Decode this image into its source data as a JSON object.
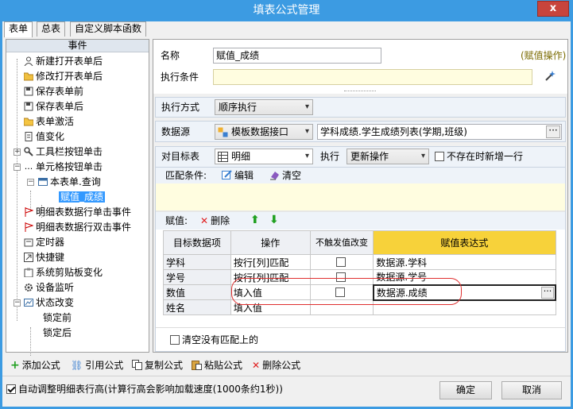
{
  "window": {
    "title": "填表公式管理",
    "close_glyph": "x"
  },
  "tabs": [
    {
      "label": "表单"
    },
    {
      "label": "总表"
    },
    {
      "label": "自定义脚本函数"
    }
  ],
  "tree": {
    "header": "事件",
    "nodes": [
      {
        "label": "新建打开表单后"
      },
      {
        "label": "修改打开表单后"
      },
      {
        "label": "保存表单前"
      },
      {
        "label": "保存表单后"
      },
      {
        "label": "表单激活"
      },
      {
        "label": "值变化"
      },
      {
        "label": "工具栏按钮单击"
      },
      {
        "label": "单元格按钮单击"
      },
      {
        "label": "本表单.查询"
      },
      {
        "label": "赋值_成绩"
      },
      {
        "label": "明细表数据行单击事件"
      },
      {
        "label": "明细表数据行双击事件"
      },
      {
        "label": "定时器"
      },
      {
        "label": "快捷键"
      },
      {
        "label": "系统剪贴板变化"
      },
      {
        "label": "设备监听"
      },
      {
        "label": "状态改变"
      },
      {
        "label": "锁定前"
      },
      {
        "label": "锁定后"
      }
    ]
  },
  "form": {
    "name_label": "名称",
    "name_value": "赋值_成绩",
    "op_type": "(赋值操作)",
    "cond_label": "执行条件",
    "cond_value": "",
    "exec_mode_label": "执行方式",
    "exec_mode_value": "顺序执行",
    "datasource_label": "数据源",
    "datasource_type": "模板数据接口",
    "datasource_value": "学科成绩.学生成绩列表(学期,班级)",
    "target_label": "对目标表",
    "target_value": "明细",
    "exec_label": "执行",
    "exec_value": "更新操作",
    "add_row_label": "不存在时新增一行",
    "match_label": "匹配条件:",
    "edit_label": "编辑",
    "clear_label": "清空",
    "assign_label": "赋值:",
    "delete_label": "删除",
    "clear_unmatched_label": "清空没有匹配上的"
  },
  "grid": {
    "headers": [
      "目标数据项",
      "操作",
      "不触发值改变",
      "赋值表达式"
    ],
    "rows": [
      {
        "target": "学科",
        "op": "按行[列]匹配",
        "nochange": false,
        "expr": "数据源.学科"
      },
      {
        "target": "学号",
        "op": "按行[列]匹配",
        "nochange": false,
        "expr": "数据源.学号"
      },
      {
        "target": "数值",
        "op": "填入值",
        "nochange": false,
        "expr": "数据源.成绩"
      },
      {
        "target": "姓名",
        "op": "填入值",
        "nochange": false,
        "expr": ""
      }
    ]
  },
  "toolbar": {
    "add": "添加公式",
    "ref": "引用公式",
    "copy": "复制公式",
    "paste": "粘贴公式",
    "del": "删除公式"
  },
  "footer": {
    "auto_height_label": "自动调整明细表行高(计算行高会影响加载速度(1000条约1秒))",
    "auto_height_checked": true,
    "ok": "确定",
    "cancel": "取消"
  },
  "colors": {
    "title_bar": "#3c9be2",
    "selection": "#3399ff",
    "highlight_header": "#f7d23a",
    "condition_bg": "#fffde0",
    "annotation": "#e03030"
  }
}
